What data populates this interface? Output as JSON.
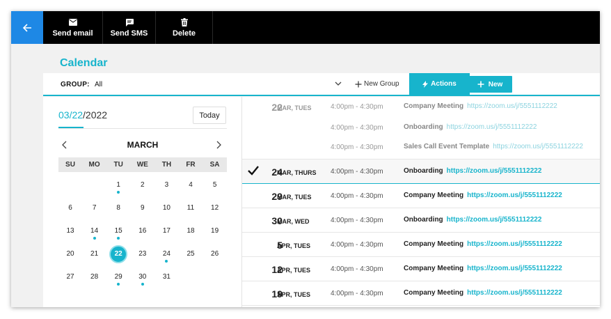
{
  "toolbar": {
    "send_email": "Send email",
    "send_sms": "Send SMS",
    "delete": "Delete"
  },
  "page": {
    "title": "Calendar"
  },
  "filter": {
    "group_label": "GROUP:",
    "group_value": "All",
    "new_group": "New Group",
    "actions": "Actions",
    "new": "New"
  },
  "calendar": {
    "date_month_day": "03/22",
    "date_year": "/2022",
    "today": "Today",
    "month": "MARCH",
    "weekdays": [
      "SU",
      "MO",
      "TU",
      "WE",
      "TH",
      "FR",
      "SA"
    ],
    "first_weekday": 2,
    "days_in_month": 31,
    "selected_day": 22,
    "event_days": [
      1,
      14,
      15,
      24,
      29,
      30
    ]
  },
  "events": [
    {
      "day": "22",
      "weekday": "MAR, TUES",
      "time": "4:00pm - 4:30pm",
      "name": "Company Meeting",
      "link": "https://zoom.us/j/5551112222",
      "faded": true
    },
    {
      "day": "",
      "weekday": "",
      "time": "4:00pm - 4:30pm",
      "name": "Onboarding",
      "link": "https://zoom.us/j/5551112222",
      "faded": true
    },
    {
      "day": "",
      "weekday": "",
      "time": "4:00pm - 4:30pm",
      "name": "Sales Call Event Template",
      "link": "https://zoom.us/j/5551112222",
      "faded": true
    },
    {
      "day": "24",
      "weekday": "MAR, THURS",
      "time": "4:00pm - 4:30pm",
      "name": "Onboarding",
      "link": "https://zoom.us/j/5551112222",
      "checked": true
    },
    {
      "day": "29",
      "weekday": "MAR, TUES",
      "time": "4:00pm - 4:30pm",
      "name": "Company Meeting",
      "link": "https://zoom.us/j/5551112222"
    },
    {
      "day": "30",
      "weekday": "MAR, WED",
      "time": "4:00pm - 4:30pm",
      "name": "Onboarding",
      "link": "https://zoom.us/j/5551112222"
    },
    {
      "day": "5",
      "weekday": "APR, TUES",
      "time": "4:00pm - 4:30pm",
      "name": "Company Meeting",
      "link": "https://zoom.us/j/5551112222"
    },
    {
      "day": "12",
      "weekday": "APR, TUES",
      "time": "4:00pm - 4:30pm",
      "name": "Company Meeting",
      "link": "https://zoom.us/j/5551112222"
    },
    {
      "day": "19",
      "weekday": "APR, TUES",
      "time": "4:00pm - 4:30pm",
      "name": "Company Meeting",
      "link": "https://zoom.us/j/5551112222"
    }
  ]
}
